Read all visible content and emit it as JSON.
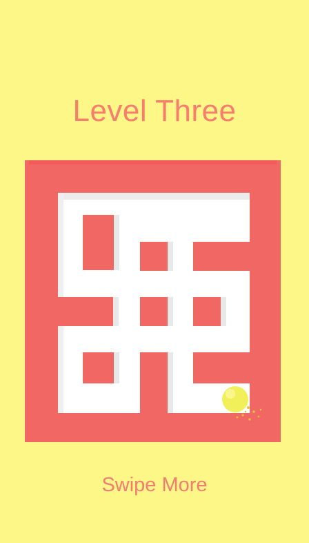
{
  "level": {
    "title": "Level Three",
    "hint": "Swipe More"
  },
  "colors": {
    "background": "#fdf787",
    "title": "#f77d6d",
    "wall_front": "#f06a66",
    "wall_top": "#f75d5e",
    "floor": "#ffffff",
    "floor_shadow": "#e6e6e6",
    "ball": "#f2f05a"
  },
  "icons": {
    "ball": "ball-icon",
    "sparkles": "particle-sparkles"
  }
}
